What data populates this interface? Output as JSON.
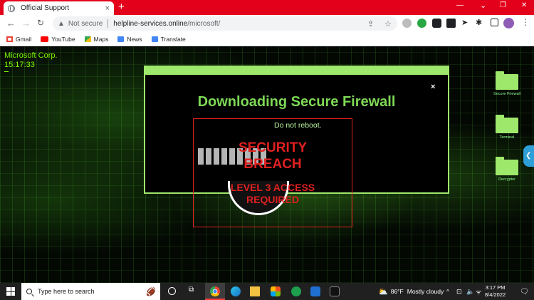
{
  "browser": {
    "tab_title": "Official Support",
    "tab_close": "×",
    "new_tab": "+",
    "window_controls": {
      "minimize": "—",
      "maximize": "❐",
      "close": "✕"
    },
    "back": "←",
    "forward": "→",
    "reload": "C",
    "security_label": "Not secure",
    "url_host": "helpline-services.online",
    "url_path": "/microsoft/",
    "share_icon": "share-icon",
    "star_icon": "star-icon",
    "extensions_icon": "puzzle-icon",
    "menu_glyph": "⋮"
  },
  "bookmarks": [
    {
      "label": "Gmail",
      "icon": "gmail-icon",
      "color": "#ea4335"
    },
    {
      "label": "YouTube",
      "icon": "youtube-icon",
      "color": "#ff0000"
    },
    {
      "label": "Maps",
      "icon": "maps-icon",
      "color": "#34a853"
    },
    {
      "label": "News",
      "icon": "news-icon",
      "color": "#4285f4"
    },
    {
      "label": "Translate",
      "icon": "translate-icon",
      "color": "#4285f4"
    }
  ],
  "page": {
    "corp_name": "Microsoft Corp.",
    "corp_time": "15:17:33",
    "desktop_icons": [
      {
        "label": "Secure Firewall"
      },
      {
        "label": "Terminal"
      },
      {
        "label": "Decryptor"
      }
    ],
    "side_tab_glyph": "❮",
    "modal": {
      "close": "×",
      "title": "Downloading Secure Firewall",
      "subtitle": "Do not reboot.",
      "progress_blocks": 9
    },
    "breach_line1": "SECURITY",
    "breach_line2": "BREACH",
    "breach_line3": "LEVEL 3 ACCESS",
    "breach_line4": "REQUIRED",
    "colors": {
      "accent_green": "#9ee86b",
      "alert_red": "#e02020",
      "chrome_red": "#e3001b"
    }
  },
  "taskbar": {
    "search_placeholder": "Type here to search",
    "weather_temp": "86°F",
    "weather_desc": "Mostly cloudy",
    "time": "3:17 PM",
    "date": "8/4/2022",
    "tray_caret": "^"
  }
}
